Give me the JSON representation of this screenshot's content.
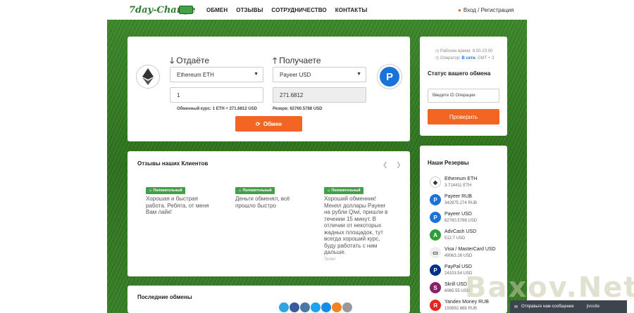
{
  "header": {
    "logo": "7day-Change",
    "nav": [
      "ОБМЕН",
      "ОТЗЫВЫ",
      "СОТРУДНИЧЕСТВО",
      "КОНТАКТЫ"
    ],
    "login": "Вход / Регистрация"
  },
  "exchange": {
    "give_label": "Отдаёте",
    "get_label": "Получаете",
    "give_currency": "Ethereum ETH",
    "get_currency": "Payeer USD",
    "give_amount": "1",
    "get_amount": "271.6812",
    "rate": "Обменный курс: 1 ETH = 271.6812 USD",
    "reserve": "Резерв: 62760.5788 USD",
    "button": "Обмен"
  },
  "status": {
    "work_time": "Рабочее время: 8:00-23:00",
    "operator_label": "Оператор:",
    "operator_state": "В сети",
    "operator_extra": ", GMT + 3",
    "title": "Статус вашего обмена",
    "input_placeholder": "Введите ID Операции",
    "button": "Проверить"
  },
  "reviews": {
    "title": "Отзывы наших Клиентов",
    "items": [
      {
        "badge": "Положительный",
        "text": "Хорошая и быстрая работа. Ребята, от меня Вам лайк!",
        "author": ""
      },
      {
        "badge": "Положительный",
        "text": "Деньги обменял, всё прошло быстро",
        "author": ""
      },
      {
        "badge": "Положительный",
        "text": "Хороший обменник! Менял доллары Payeer на рубли Qiwi, пришли в течении 15 минут. В отличии от некоторых жадных площадок, тут всегда хороший курс, буду работать с ним дальше.",
        "author": "Tester"
      }
    ]
  },
  "reserves": {
    "title": "Наши Резервы",
    "items": [
      {
        "name": "Ethereum ETH",
        "amount": "3.714411 ETH",
        "color": "#ffffff",
        "icon": "ethereum-icon"
      },
      {
        "name": "Payeer RUB",
        "amount": "342875.274 RUB",
        "color": "#1a73d9",
        "icon": "payeer-icon"
      },
      {
        "name": "Payeer USD",
        "amount": "62760.5788 USD",
        "color": "#1a73d9",
        "icon": "payeer-icon"
      },
      {
        "name": "AdvCash USD",
        "amount": "512.7 USD",
        "color": "#2e9e3c",
        "icon": "advcash-icon"
      },
      {
        "name": "Visa / MasterCard USD",
        "amount": "49063.26 USD",
        "color": "#eeeeee",
        "icon": "card-icon"
      },
      {
        "name": "PayPal USD",
        "amount": "24103.54 USD",
        "color": "#003087",
        "icon": "paypal-icon"
      },
      {
        "name": "Skrill USD",
        "amount": "6965.55 USD",
        "color": "#862165",
        "icon": "skrill-icon"
      },
      {
        "name": "Yandex Money RUB",
        "amount": "193992.868 RUB",
        "color": "#e52620",
        "icon": "yandex-icon"
      }
    ]
  },
  "last_exchanges": {
    "title": "Последние обмены"
  },
  "chat": {
    "label": "Отправьте нам сообщение",
    "brand": "jivosite"
  },
  "watermark": "Baxov.Net"
}
